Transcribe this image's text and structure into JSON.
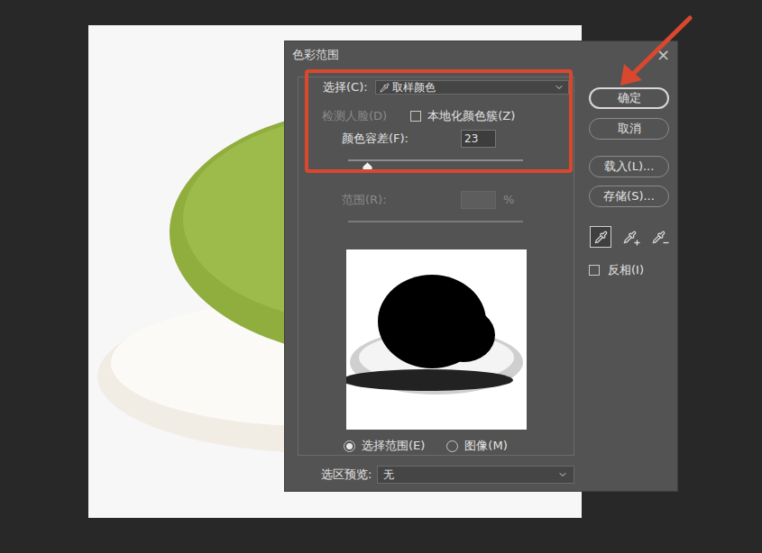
{
  "window": {
    "title": "色彩范围",
    "close": "×"
  },
  "select": {
    "label": "选择(C):",
    "value": "取样颜色"
  },
  "detect_faces": {
    "label": "检测人脸(D)",
    "checked": false,
    "disabled": true
  },
  "localized_clusters": {
    "label": "本地化颜色簇(Z)",
    "checked": false
  },
  "fuzziness": {
    "label": "颜色容差(F):",
    "value": "23",
    "level": 0.11
  },
  "range": {
    "label": "范围(R):",
    "value": "",
    "unit": "%",
    "disabled": true
  },
  "range_slider": {
    "disabled": true
  },
  "preview_modes": [
    {
      "label": "选择范围(E)",
      "selected": true
    },
    {
      "label": "图像(M)",
      "selected": false
    }
  ],
  "selection_preview": {
    "label": "选区预览:",
    "value": "无"
  },
  "buttons": [
    {
      "label": "确定",
      "default": true
    },
    {
      "label": "取消",
      "default": false
    },
    {
      "label": "载入(L)...",
      "default": false
    },
    {
      "label": "存储(S)...",
      "default": false
    }
  ],
  "eyedroppers": [
    {
      "kind": "sample",
      "selected": true
    },
    {
      "kind": "add",
      "selected": false
    },
    {
      "kind": "subtract",
      "selected": false
    }
  ],
  "invert": {
    "label": "反相(I)",
    "checked": false
  }
}
